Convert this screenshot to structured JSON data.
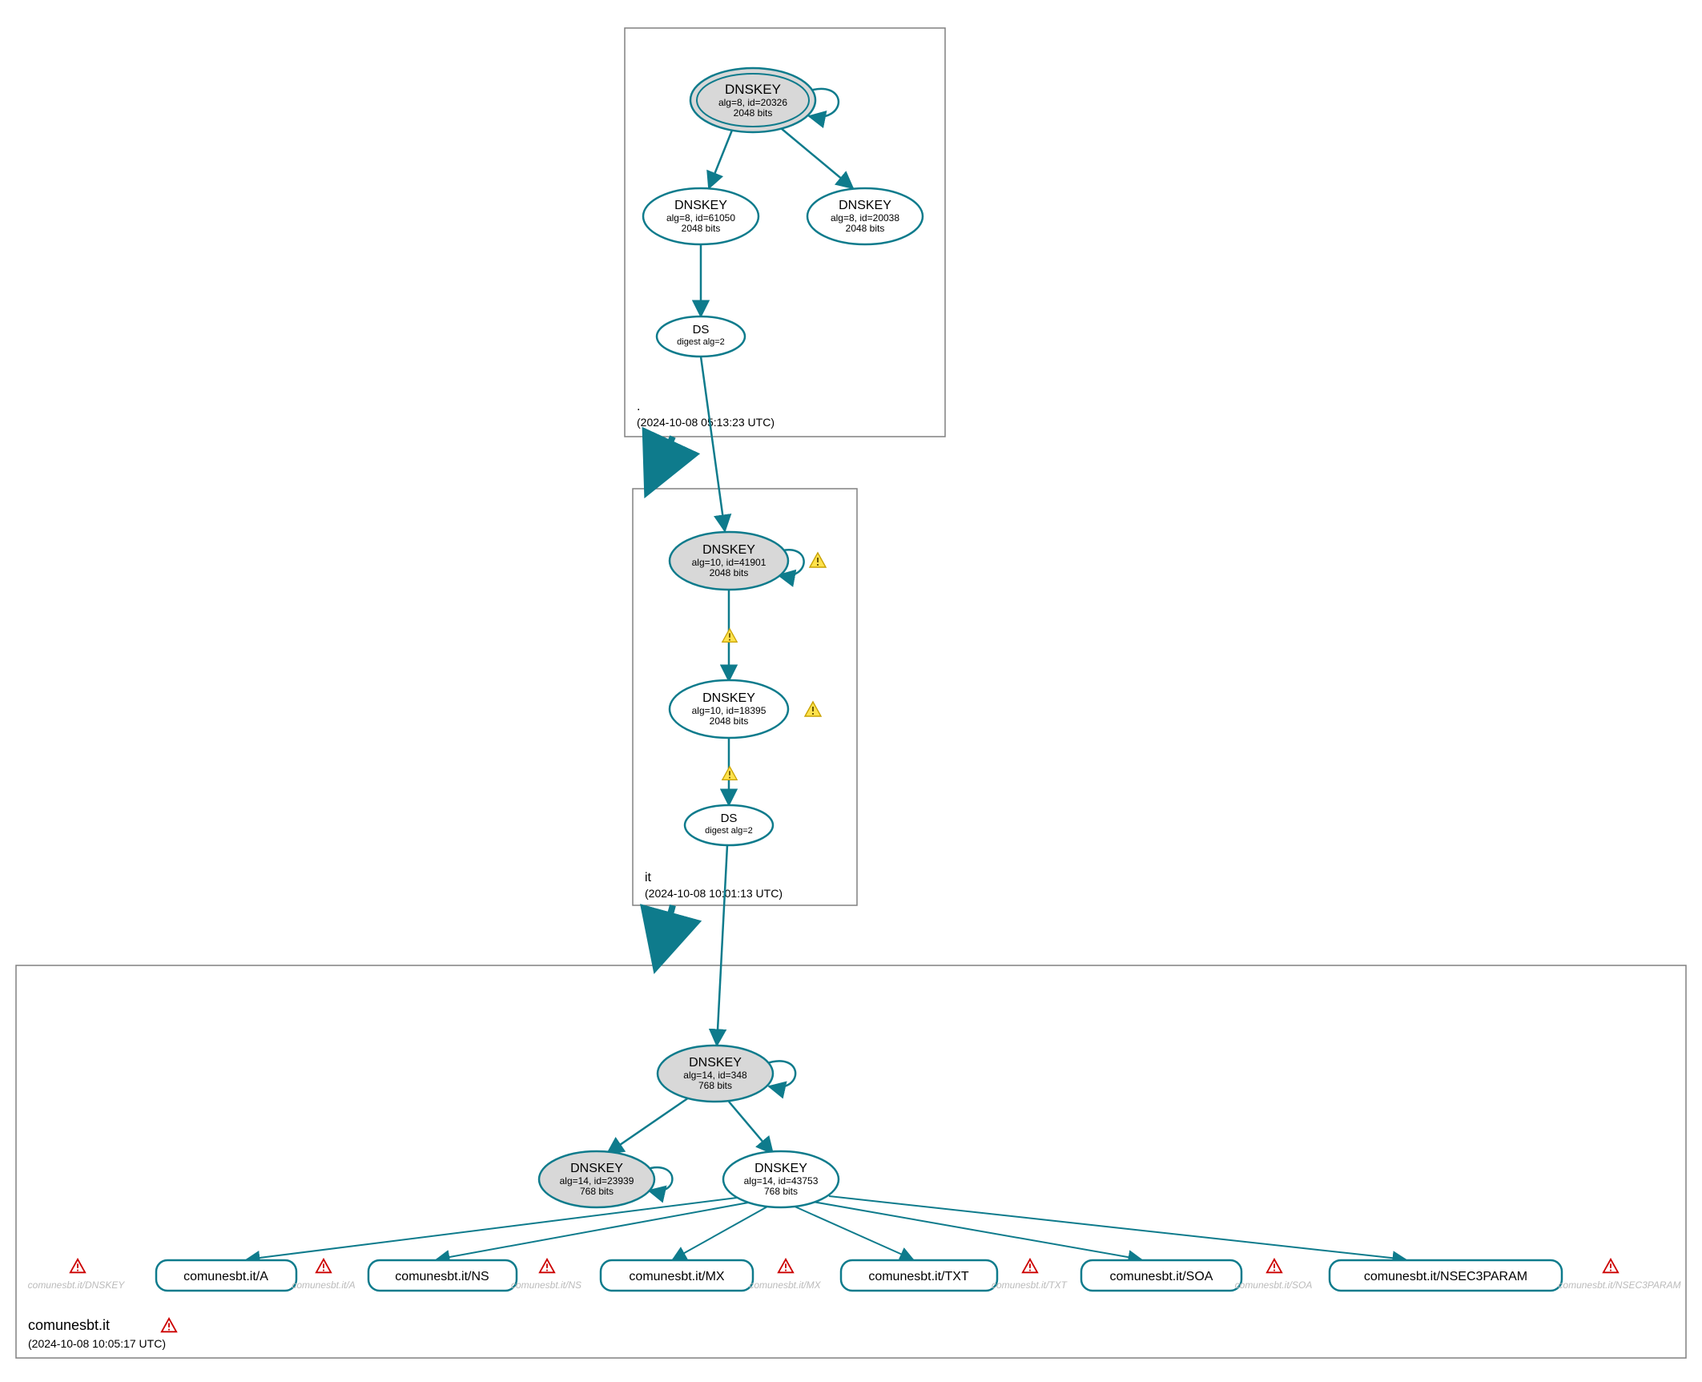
{
  "zones": {
    "root": {
      "label": ".",
      "timestamp": "(2024-10-08 05:13:23 UTC)"
    },
    "it": {
      "label": "it",
      "timestamp": "(2024-10-08 10:01:13 UTC)"
    },
    "leaf": {
      "label": "comunesbt.it",
      "timestamp": "(2024-10-08 10:05:17 UTC)"
    }
  },
  "nodes": {
    "root_ksk": {
      "l1": "DNSKEY",
      "l2": "alg=8, id=20326",
      "l3": "2048 bits"
    },
    "root_zsk1": {
      "l1": "DNSKEY",
      "l2": "alg=8, id=61050",
      "l3": "2048 bits"
    },
    "root_zsk2": {
      "l1": "DNSKEY",
      "l2": "alg=8, id=20038",
      "l3": "2048 bits"
    },
    "root_ds": {
      "l1": "DS",
      "l2": "digest alg=2"
    },
    "it_ksk": {
      "l1": "DNSKEY",
      "l2": "alg=10, id=41901",
      "l3": "2048 bits"
    },
    "it_zsk": {
      "l1": "DNSKEY",
      "l2": "alg=10, id=18395",
      "l3": "2048 bits"
    },
    "it_ds": {
      "l1": "DS",
      "l2": "digest alg=2"
    },
    "leaf_ksk": {
      "l1": "DNSKEY",
      "l2": "alg=14, id=348",
      "l3": "768 bits"
    },
    "leaf_zsk1": {
      "l1": "DNSKEY",
      "l2": "alg=14, id=23939",
      "l3": "768 bits"
    },
    "leaf_zsk2": {
      "l1": "DNSKEY",
      "l2": "alg=14, id=43753",
      "l3": "768 bits"
    },
    "rr_a": {
      "label": "comunesbt.it/A"
    },
    "rr_ns": {
      "label": "comunesbt.it/NS"
    },
    "rr_mx": {
      "label": "comunesbt.it/MX"
    },
    "rr_txt": {
      "label": "comunesbt.it/TXT"
    },
    "rr_soa": {
      "label": "comunesbt.it/SOA"
    },
    "rr_n3p": {
      "label": "comunesbt.it/NSEC3PARAM"
    }
  },
  "shadows": {
    "s_dnskey": {
      "label": "comunesbt.it/DNSKEY"
    },
    "s_a": {
      "label": "comunesbt.it/A"
    },
    "s_ns": {
      "label": "comunesbt.it/NS"
    },
    "s_mx": {
      "label": "comunesbt.it/MX"
    },
    "s_txt": {
      "label": "comunesbt.it/TXT"
    },
    "s_soa": {
      "label": "comunesbt.it/SOA"
    },
    "s_n3p": {
      "label": "comunesbt.it/NSEC3PARAM"
    }
  },
  "colors": {
    "stroke": "#0e7b8c",
    "box": "#808080",
    "grey_fill": "#d8d8d8",
    "shadow_text": "#bbbbbb",
    "black": "#000000"
  }
}
